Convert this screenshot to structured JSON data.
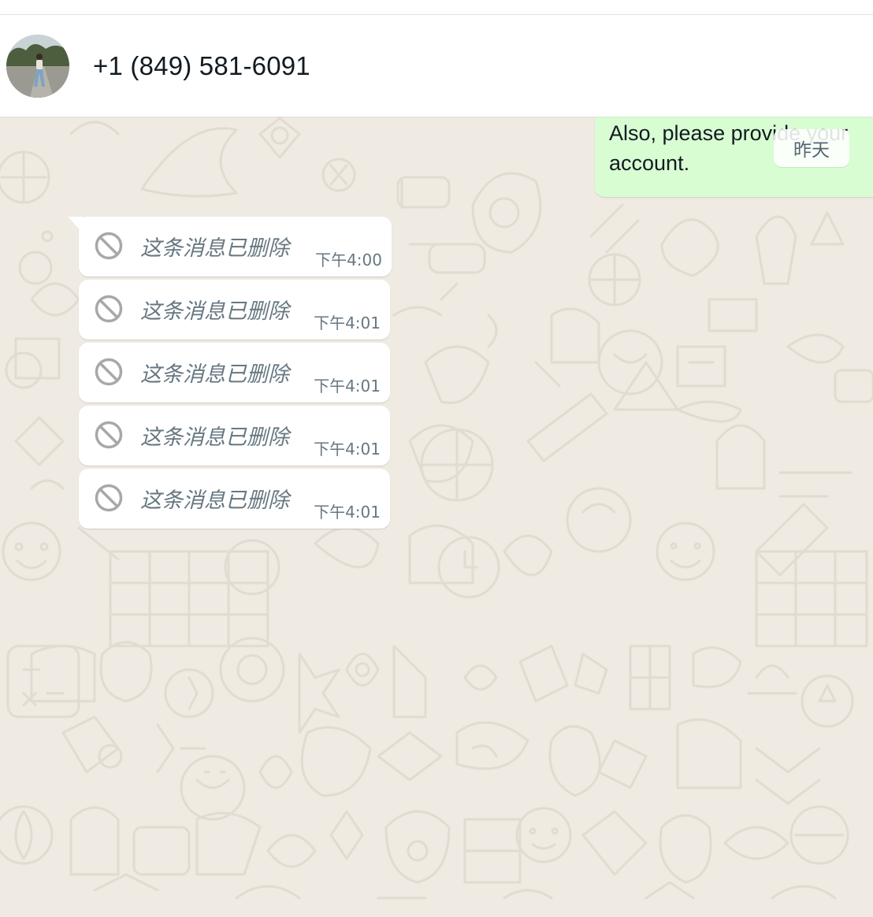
{
  "chat": {
    "contact_name": "+1 (849) 581-6091",
    "date_separator": "昨天"
  },
  "outgoing_message": {
    "text": "do well.\nAlso, please provide your\naccount."
  },
  "messages": [
    {
      "text": "这条消息已删除",
      "time": "下午4:00"
    },
    {
      "text": "这条消息已删除",
      "time": "下午4:01"
    },
    {
      "text": "这条消息已删除",
      "time": "下午4:01"
    },
    {
      "text": "这条消息已删除",
      "time": "下午4:01"
    },
    {
      "text": "这条消息已删除",
      "time": "下午4:01"
    }
  ],
  "colors": {
    "wallpaper": "#efeae2",
    "incoming_bubble": "#ffffff",
    "outgoing_bubble": "#d9fdd3",
    "meta_text": "#667781"
  }
}
